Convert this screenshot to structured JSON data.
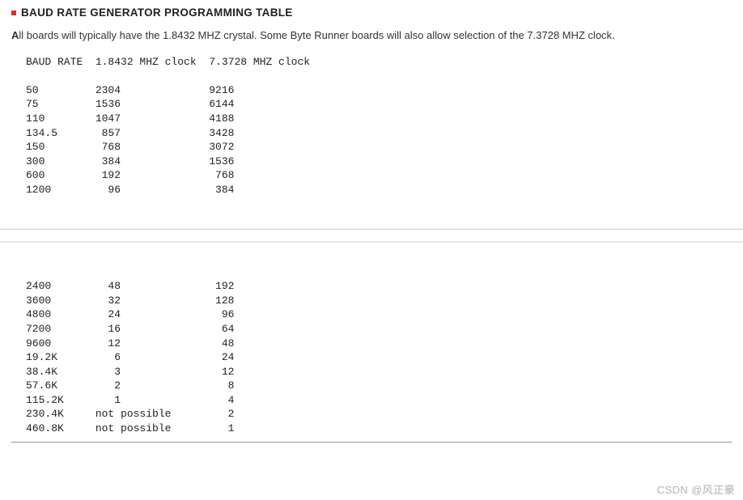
{
  "heading": "BAUD RATE GENERATOR PROGRAMMING TABLE",
  "intro": {
    "first_char": "A",
    "rest": "ll boards will typically have the 1.8432 MHZ crystal. Some Byte Runner boards will also allow selection of the 7.3728 MHZ clock."
  },
  "chart_data": {
    "type": "table",
    "columns": [
      "BAUD RATE",
      "1.8432 MHZ clock",
      "7.3728 MHZ clock"
    ],
    "rows_upper": [
      [
        "50",
        "2304",
        "9216"
      ],
      [
        "75",
        "1536",
        "6144"
      ],
      [
        "110",
        "1047",
        "4188"
      ],
      [
        "134.5",
        "857",
        "3428"
      ],
      [
        "150",
        "768",
        "3072"
      ],
      [
        "300",
        "384",
        "1536"
      ],
      [
        "600",
        "192",
        "768"
      ],
      [
        "1200",
        "96",
        "384"
      ]
    ],
    "rows_lower": [
      [
        "2400",
        "48",
        "192"
      ],
      [
        "3600",
        "32",
        "128"
      ],
      [
        "4800",
        "24",
        "96"
      ],
      [
        "7200",
        "16",
        "64"
      ],
      [
        "9600",
        "12",
        "48"
      ],
      [
        "19.2K",
        "6",
        "24"
      ],
      [
        "38.4K",
        "3",
        "12"
      ],
      [
        "57.6K",
        "2",
        "8"
      ],
      [
        "115.2K",
        "1",
        "4"
      ],
      [
        "230.4K",
        "not possible",
        "2"
      ],
      [
        "460.8K",
        "not possible",
        "1"
      ]
    ]
  },
  "watermark": "CSDN @风正豪"
}
